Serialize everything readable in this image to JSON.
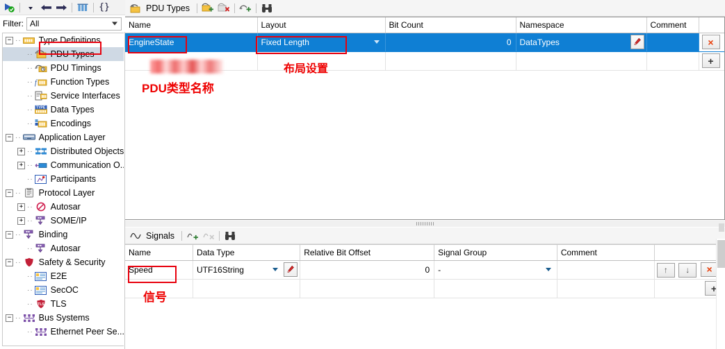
{
  "left": {
    "toolbar": {
      "run_icon": "run-check-icon",
      "dropdown_icon": "dropdown-arrow-icon",
      "back_icon": "back-arrow-icon",
      "forward_icon": "forward-arrow-icon",
      "columns_icon": "columns-icon",
      "braces_icon": "braces-icon"
    },
    "filter": {
      "label": "Filter:",
      "value": "All",
      "placeholder": "All"
    },
    "tree": [
      {
        "label": "Type Definitions",
        "depth": 0,
        "expander": "minus",
        "icon": "type-definitions-icon",
        "selected": false
      },
      {
        "label": "PDU Types",
        "depth": 1,
        "expander": "none",
        "icon": "pdu-types-icon",
        "selected": true
      },
      {
        "label": "PDU Timings",
        "depth": 1,
        "expander": "none",
        "icon": "pdu-timings-icon",
        "selected": false
      },
      {
        "label": "Function Types",
        "depth": 1,
        "expander": "none",
        "icon": "function-types-icon",
        "selected": false
      },
      {
        "label": "Service Interfaces",
        "depth": 1,
        "expander": "none",
        "icon": "service-interfaces-icon",
        "selected": false
      },
      {
        "label": "Data Types",
        "depth": 1,
        "expander": "none",
        "icon": "data-types-icon",
        "selected": false
      },
      {
        "label": "Encodings",
        "depth": 1,
        "expander": "none",
        "icon": "encodings-icon",
        "selected": false
      },
      {
        "label": "Application Layer",
        "depth": 0,
        "expander": "minus",
        "icon": "application-layer-icon",
        "selected": false
      },
      {
        "label": "Distributed Objects",
        "depth": 1,
        "expander": "plus",
        "icon": "distributed-objects-icon",
        "selected": false
      },
      {
        "label": "Communication O...",
        "depth": 1,
        "expander": "plus",
        "icon": "communication-objects-icon",
        "selected": false
      },
      {
        "label": "Participants",
        "depth": 1,
        "expander": "none",
        "icon": "participants-icon",
        "selected": false
      },
      {
        "label": "Protocol Layer",
        "depth": 0,
        "expander": "minus",
        "icon": "protocol-layer-icon",
        "selected": false
      },
      {
        "label": "Autosar",
        "depth": 1,
        "expander": "plus",
        "icon": "autosar-icon",
        "selected": false
      },
      {
        "label": "SOME/IP",
        "depth": 1,
        "expander": "plus",
        "icon": "someip-icon",
        "selected": false
      },
      {
        "label": "Binding",
        "depth": 0,
        "expander": "minus",
        "icon": "binding-icon",
        "selected": false
      },
      {
        "label": "Autosar",
        "depth": 1,
        "expander": "none",
        "icon": "binding-autosar-icon",
        "selected": false
      },
      {
        "label": "Safety & Security",
        "depth": 0,
        "expander": "minus",
        "icon": "safety-security-icon",
        "selected": false
      },
      {
        "label": "E2E",
        "depth": 1,
        "expander": "none",
        "icon": "e2e-icon",
        "selected": false
      },
      {
        "label": "SecOC",
        "depth": 1,
        "expander": "none",
        "icon": "secoc-icon",
        "selected": false
      },
      {
        "label": "TLS",
        "depth": 1,
        "expander": "none",
        "icon": "tls-icon",
        "selected": false
      },
      {
        "label": "Bus Systems",
        "depth": 0,
        "expander": "minus",
        "icon": "bus-systems-icon",
        "selected": false
      },
      {
        "label": "Ethernet Peer Se...",
        "depth": 1,
        "expander": "none",
        "icon": "ethernet-peer-icon",
        "selected": false
      }
    ]
  },
  "pdu_panel": {
    "title": "PDU Types",
    "title_icon": "pdu-types-icon",
    "buttons": {
      "add_pdu": "add-pdu-type-icon",
      "delete_pdu": "delete-pdu-type-icon",
      "add_variant": "add-pdu-variant-icon",
      "find": "find-binoculars-icon"
    },
    "columns": [
      "Name",
      "Layout",
      "Bit Count",
      "Namespace",
      "Comment"
    ],
    "row": {
      "name": "EngineState",
      "layout": "Fixed Length",
      "bit_count": "0",
      "namespace": "DataTypes",
      "comment": ""
    },
    "row_actions": {
      "delete": "×",
      "add": "+"
    },
    "namespace_edit_icon": "pencil-edit-icon"
  },
  "signals_panel": {
    "title": "Signals",
    "title_icon": "signal-wave-icon",
    "buttons": {
      "add_signal": "add-signal-icon",
      "delete_signal": "delete-signal-icon",
      "find": "find-binoculars-icon"
    },
    "columns": [
      "Name",
      "Data Type",
      "Relative Bit Offset",
      "Signal Group",
      "Comment"
    ],
    "row": {
      "name": "Speed",
      "data_type": "UTF16String",
      "relative_bit_offset": "0",
      "signal_group": "-",
      "comment": ""
    },
    "row_actions": {
      "move_up": "↑",
      "move_down": "↓",
      "delete": "×",
      "add": "+"
    },
    "data_type_edit_icon": "pencil-edit-icon"
  },
  "annotations": [
    {
      "id": "pdu-type-name",
      "text": "PDU类型名称"
    },
    {
      "id": "layout-setting",
      "text": "布局设置"
    },
    {
      "id": "signal",
      "text": "信号"
    }
  ],
  "colors": {
    "selection_blue": "#0f7fd4",
    "tree_selection": "#cfd9e4",
    "annotation_red": "#ee0000",
    "delete_x": "#e8400c"
  }
}
